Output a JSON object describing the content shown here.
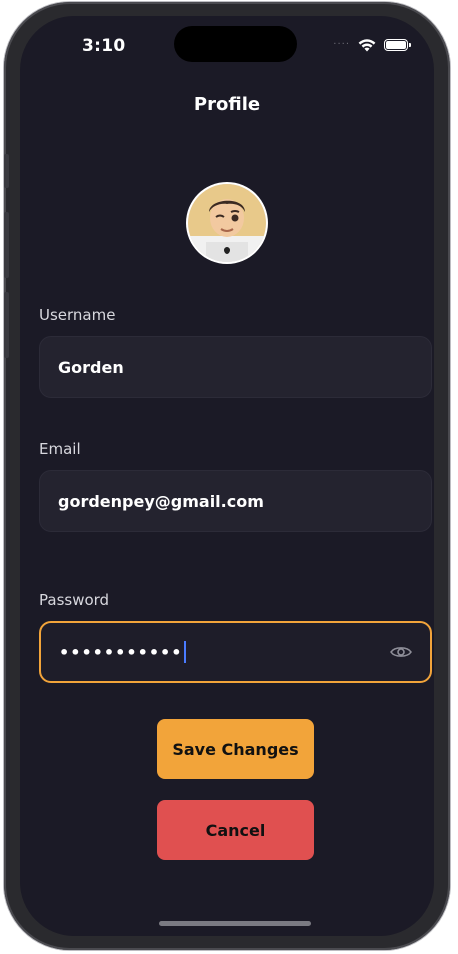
{
  "status_bar": {
    "time": "3:10",
    "signal_icon": "signal-dots-icon",
    "wifi_icon": "wifi-icon",
    "battery_icon": "battery-icon"
  },
  "header": {
    "title": "Profile"
  },
  "avatar": {
    "icon": "memoji-avatar"
  },
  "form": {
    "username": {
      "label": "Username",
      "value": "Gorden"
    },
    "email": {
      "label": "Email",
      "value": "gordenpey@gmail.com"
    },
    "password": {
      "label": "Password",
      "value": "•••••••••••",
      "toggle_icon": "eye-icon"
    }
  },
  "actions": {
    "save_label": "Save Changes",
    "cancel_label": "Cancel"
  },
  "colors": {
    "background": "#1b1a26",
    "field_bg": "#24232f",
    "accent": "#f2a43a",
    "danger": "#e05050",
    "caret": "#4a7bff"
  }
}
